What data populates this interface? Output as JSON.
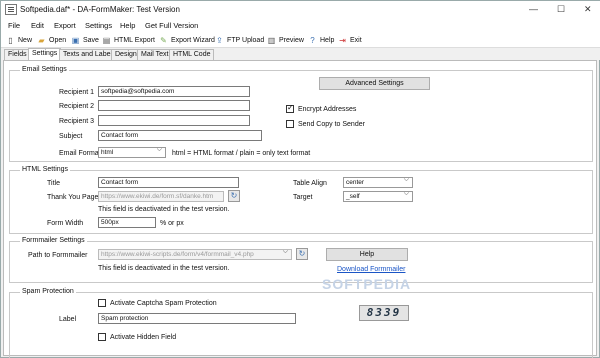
{
  "window": {
    "title": "Softpedia.daf* - DA-FormMaker: Test Version",
    "minimize": "—",
    "maximize": "☐",
    "close": "✕"
  },
  "menu": [
    "File",
    "Edit",
    "Export",
    "Settings",
    "Help",
    "Get Full Version"
  ],
  "toolbar": [
    {
      "label": "New",
      "icon": "new-doc-icon",
      "glyph": "▯",
      "color": "#444"
    },
    {
      "label": "Open",
      "icon": "open-folder-icon",
      "glyph": "▰",
      "color": "#d8a43a"
    },
    {
      "label": "Save",
      "icon": "save-icon",
      "glyph": "▣",
      "color": "#3a6fb0"
    },
    {
      "label": "HTML Export",
      "icon": "html-export-icon",
      "glyph": "▤",
      "color": "#555"
    },
    {
      "label": "Export Wizard",
      "icon": "wizard-icon",
      "glyph": "✎",
      "color": "#7a5"
    },
    {
      "label": "FTP Upload",
      "icon": "ftp-upload-icon",
      "glyph": "⇪",
      "color": "#3a6fb0"
    },
    {
      "label": "Preview",
      "icon": "preview-icon",
      "glyph": "▥",
      "color": "#555"
    },
    {
      "label": "Help",
      "icon": "help-icon",
      "glyph": "?",
      "color": "#3a6fb0"
    },
    {
      "label": "Exit",
      "icon": "exit-icon",
      "glyph": "⇥",
      "color": "#c33"
    }
  ],
  "tabs": [
    "Fields",
    "Settings",
    "Texts and Labels",
    "Design",
    "Mail Text",
    "HTML Code"
  ],
  "active_tab": "Settings",
  "email": {
    "title": "Email Settings",
    "recipient1_label": "Recipient 1",
    "recipient1_value": "softpedia@softpedia.com",
    "recipient2_label": "Recipient 2",
    "recipient3_label": "Recipient 3",
    "subject_label": "Subject",
    "subject_value": "Contact form",
    "format_label": "Email Format",
    "format_value": "html",
    "format_hint": "html = HTML format / plain = only text format",
    "advanced_button": "Advanced Settings",
    "encrypt_label": "Encrypt Addresses",
    "encrypt_checked": true,
    "copy_label": "Send Copy to Sender",
    "copy_checked": false
  },
  "html": {
    "title": "HTML Settings",
    "title_label": "Title",
    "title_value": "Contact form",
    "thankyou_label": "Thank You Page",
    "thankyou_value": "https://www.ekiwi.de/form.sf/danke.htm",
    "deactivated_note": "This field is deactivated in the test version.",
    "width_label": "Form Width",
    "width_value": "500px",
    "width_unit": "% or px",
    "align_label": "Table Align",
    "align_value": "center",
    "target_label": "Target",
    "target_value": "_self"
  },
  "formmailer": {
    "title": "Formmailer Settings",
    "path_label": "Path to Formmailer",
    "path_value": "https://www.ekiwi-scripts.de/form/v4/formmail_v4.php",
    "deactivated_note": "This field is deactivated in the test version.",
    "help_button": "Help",
    "download_link": "Download Formmailer"
  },
  "spam": {
    "title": "Spam Protection",
    "captcha_label": "Activate Captcha Spam Protection",
    "label_label": "Label",
    "label_value": "Spam protection",
    "hidden_label": "Activate Hidden Field",
    "captcha_text": "8339"
  },
  "watermark": "SOFTPEDIA"
}
